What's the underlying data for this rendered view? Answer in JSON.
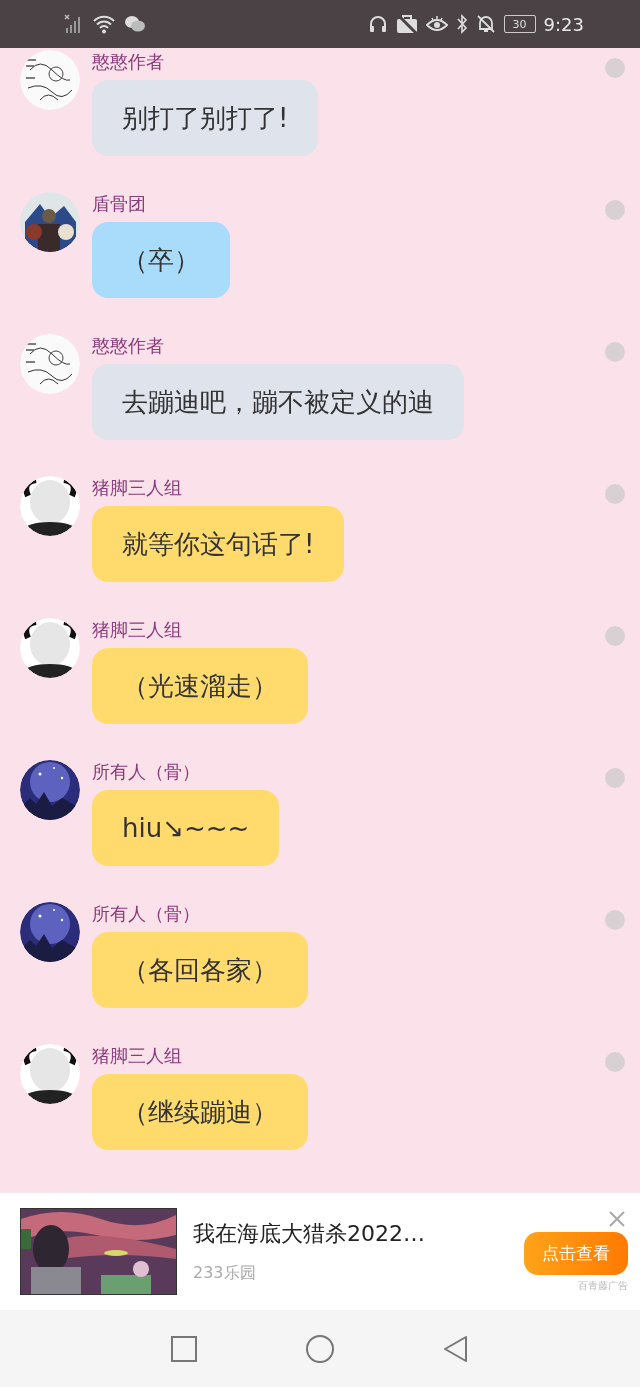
{
  "status_bar": {
    "battery": "30",
    "time": "9:23"
  },
  "messages": [
    {
      "sender": "憨憨作者",
      "kind": "sketch",
      "text": "别打了别打了!",
      "color": "#dfe3ec"
    },
    {
      "sender": "盾骨团",
      "kind": "group",
      "text": "（卒）",
      "color": "#a8dcfa"
    },
    {
      "sender": "憨憨作者",
      "kind": "sketch",
      "text": "去蹦迪吧，蹦不被定义的迪",
      "color": "#dfe3ec"
    },
    {
      "sender": "猪脚三人组",
      "kind": "face",
      "text": "就等你这句话了!",
      "color": "#ffdb6e"
    },
    {
      "sender": "猪脚三人组",
      "kind": "face",
      "text": "（光速溜走）",
      "color": "#ffdb6e"
    },
    {
      "sender": "所有人（骨）",
      "kind": "galaxy",
      "text": "hiu↘~~~",
      "color": "#ffdb6e"
    },
    {
      "sender": "所有人（骨）",
      "kind": "galaxy",
      "text": "（各回各家）",
      "color": "#ffdb6e"
    },
    {
      "sender": "猪脚三人组",
      "kind": "face",
      "text": "（继续蹦迪）",
      "color": "#ffdb6e"
    }
  ],
  "ad": {
    "title": "我在海底大猎杀2022…",
    "source": "233乐园",
    "button": "点击查看",
    "label": "百青藤广告"
  }
}
